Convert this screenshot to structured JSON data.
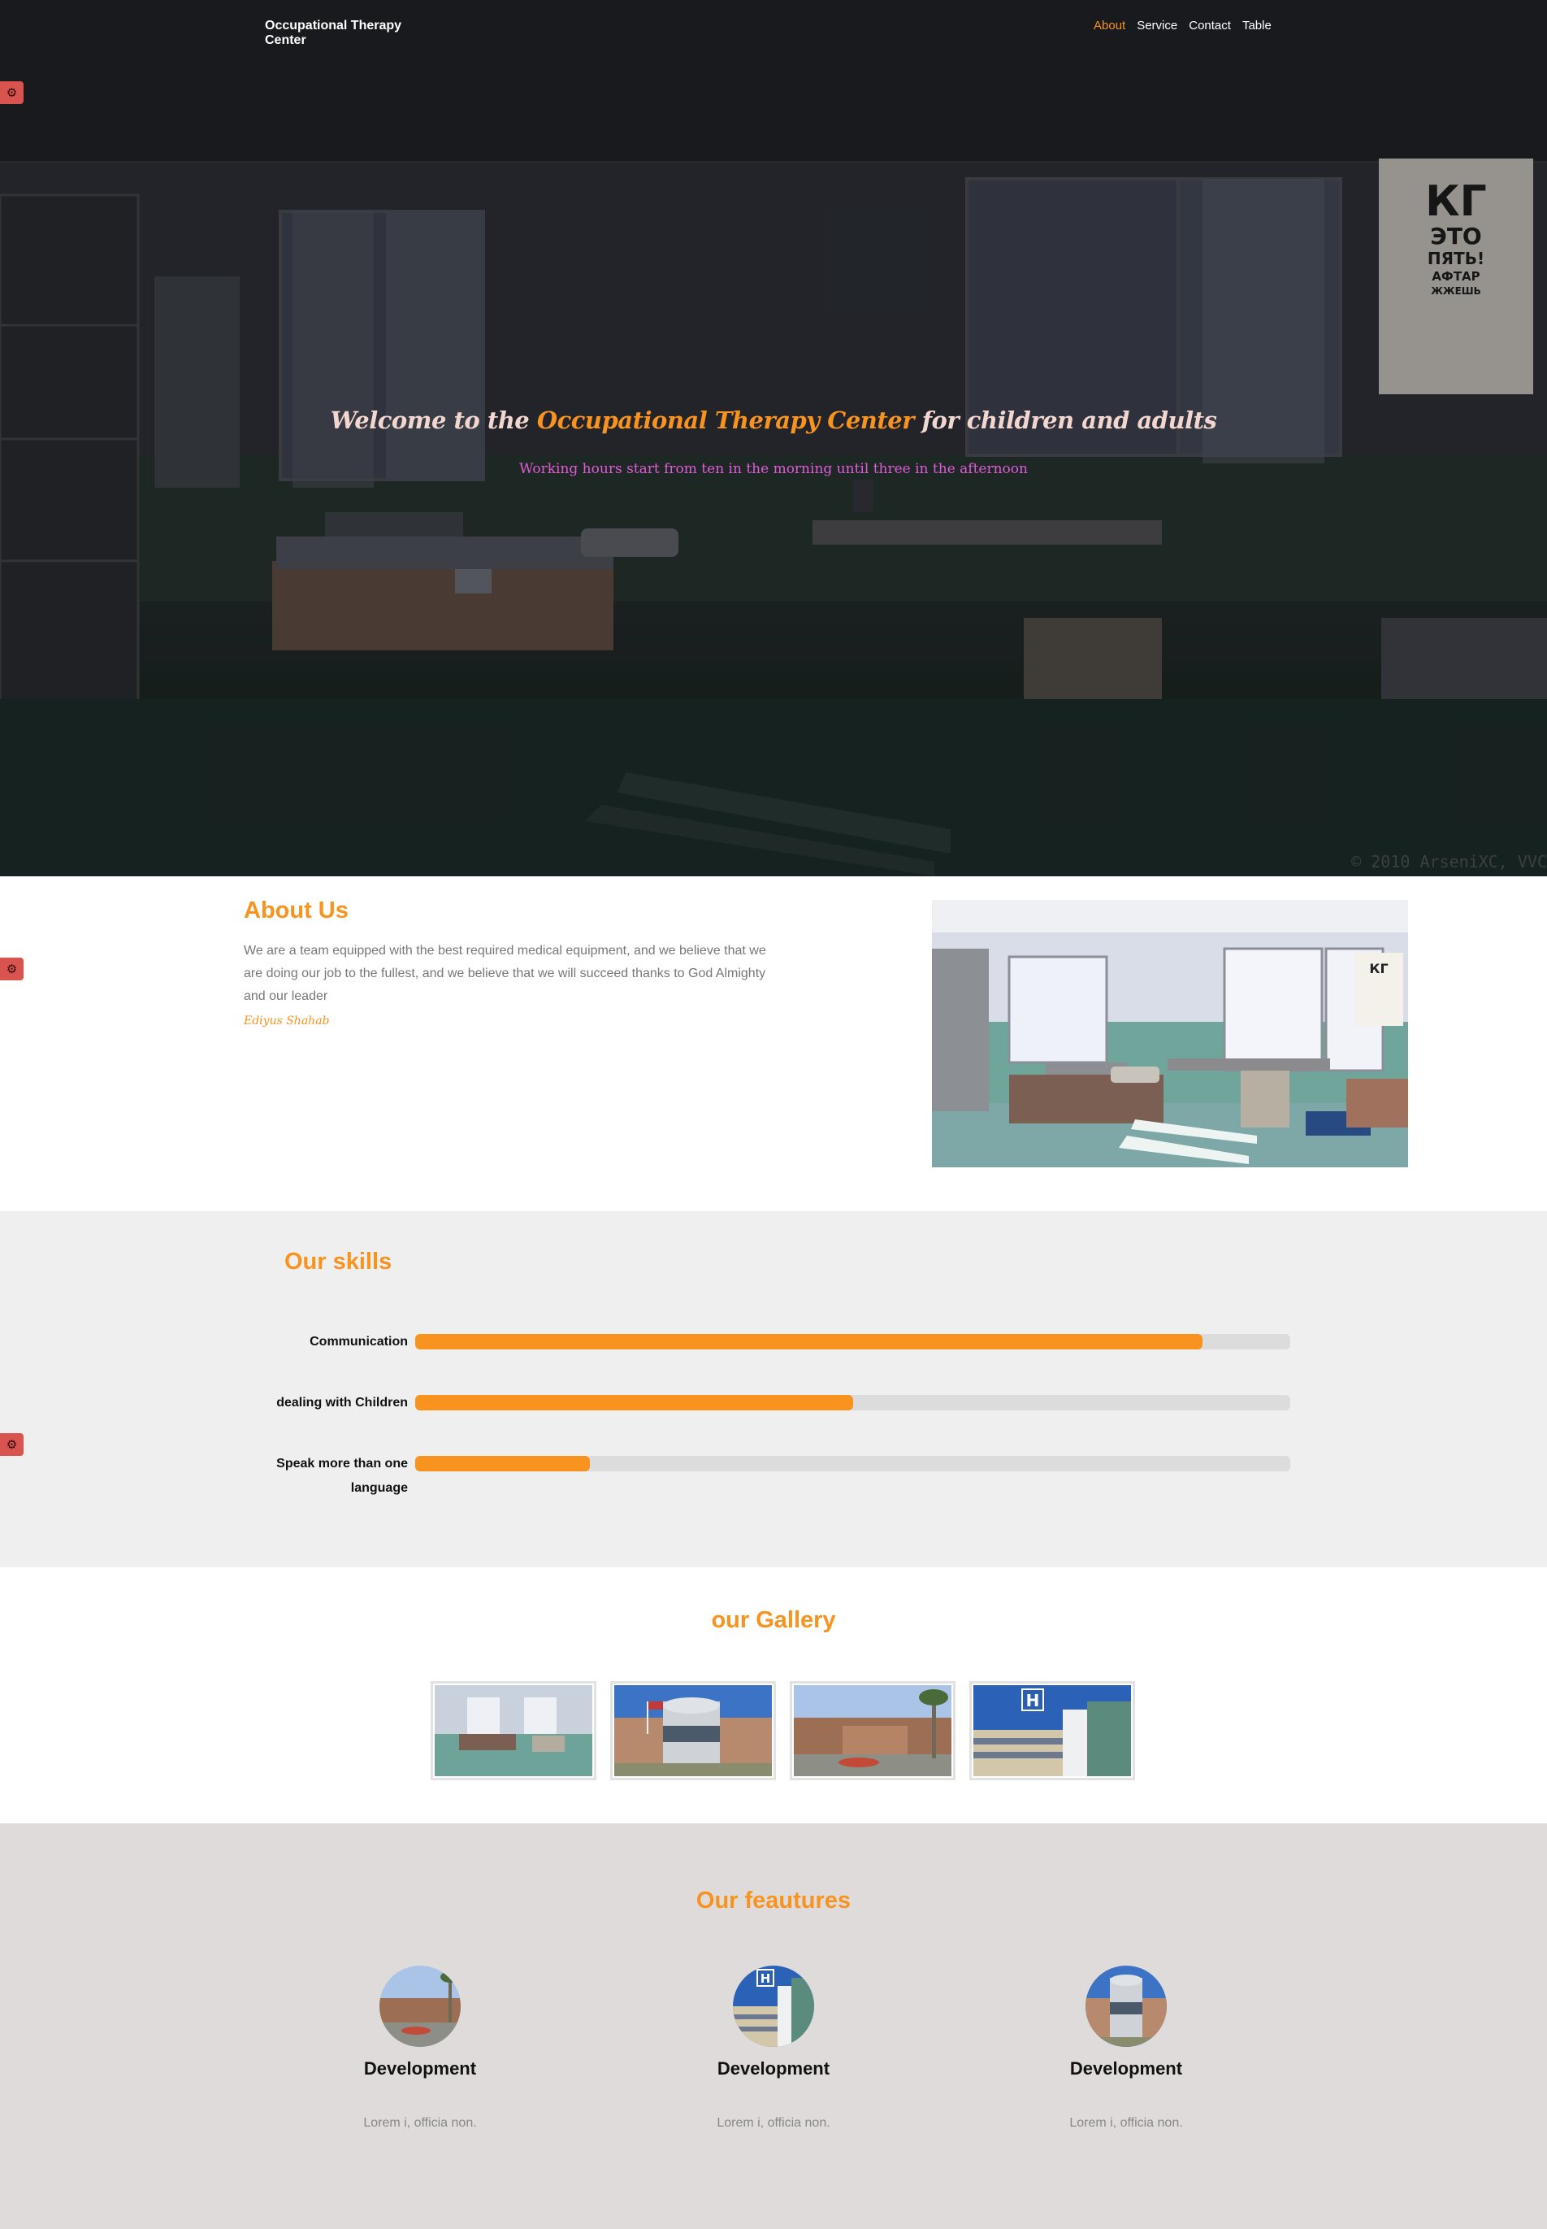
{
  "navbar": {
    "brand": "Occupational Therapy Center",
    "links": [
      {
        "label": "About",
        "active": true
      },
      {
        "label": "Service",
        "active": false
      },
      {
        "label": "Contact",
        "active": false
      },
      {
        "label": "Table",
        "active": false
      }
    ]
  },
  "hero": {
    "title_prefix": "Welcome to the ",
    "title_accent": "Occupational Therapy Center",
    "title_suffix": " for children and adults",
    "subtitle": "Working hours start from ten in the morning until three in the afternoon",
    "watermark": "© 2010 ArseniXC, VVC",
    "eye_chart": [
      "КГ",
      "ЭТО",
      "ПЯТЬ!",
      "АФТАР",
      "ЖЖЕШЬ"
    ]
  },
  "about": {
    "title": "About Us",
    "text": "We are a team equipped with the best required medical equipment, and we believe that we are doing our job to the fullest, and we believe that we will succeed thanks to God Almighty and our leader",
    "signature": "Ediyus Shahab"
  },
  "skills": {
    "title": "Our skills",
    "items": [
      {
        "label": "Communication",
        "level_percent": 90
      },
      {
        "label": "dealing with Children",
        "level_percent": 50
      },
      {
        "label": "Speak more than one language",
        "level_percent": 20
      }
    ]
  },
  "gallery": {
    "title": "our Gallery"
  },
  "features": {
    "title": "Our feautures",
    "items": [
      {
        "title": "Development",
        "text": "Lorem i, officia non."
      },
      {
        "title": "Development",
        "text": "Lorem i, officia non."
      },
      {
        "title": "Development",
        "text": "Lorem i, officia non."
      }
    ]
  },
  "colors": {
    "accent": "#f7931e",
    "settings_tab": "#d9534f",
    "subtitle": "#e05bd8"
  },
  "icons": {
    "settings": "gear-icon"
  }
}
